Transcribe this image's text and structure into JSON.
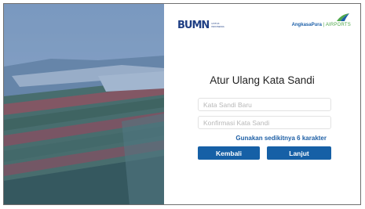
{
  "brand": {
    "bumn_logo": "BUMN",
    "bumn_subtitle": "UNTUK INDONESIA",
    "angkasa_pura_name": "AngkasaPura",
    "angkasa_pura_divider": "|",
    "angkasa_pura_tagline": "AIRPORTS",
    "primary_color": "#1660a6",
    "accent_green": "#4fa84b"
  },
  "form": {
    "title": "Atur Ulang Kata Sandi",
    "new_password_placeholder": "Kata Sandi Baru",
    "confirm_password_placeholder": "Konfirmasi Kata Sandi",
    "hint": "Gunakan sedikitnya 6 karakter",
    "back_label": "Kembali",
    "next_label": "Lanjut"
  }
}
